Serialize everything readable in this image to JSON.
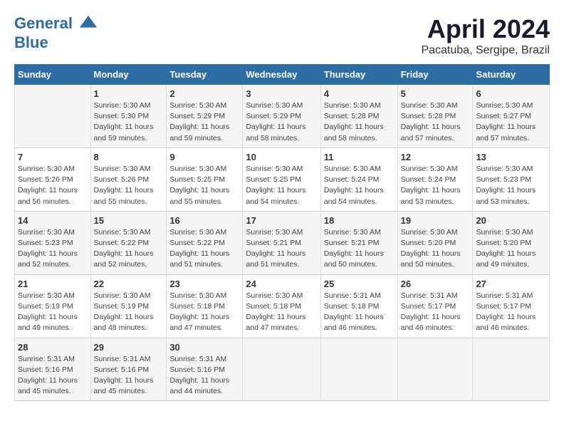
{
  "header": {
    "logo_line1": "General",
    "logo_line2": "Blue",
    "month": "April 2024",
    "location": "Pacatuba, Sergipe, Brazil"
  },
  "days_of_week": [
    "Sunday",
    "Monday",
    "Tuesday",
    "Wednesday",
    "Thursday",
    "Friday",
    "Saturday"
  ],
  "weeks": [
    [
      {
        "day": "",
        "info": ""
      },
      {
        "day": "1",
        "info": "Sunrise: 5:30 AM\nSunset: 5:30 PM\nDaylight: 11 hours\nand 59 minutes."
      },
      {
        "day": "2",
        "info": "Sunrise: 5:30 AM\nSunset: 5:29 PM\nDaylight: 11 hours\nand 59 minutes."
      },
      {
        "day": "3",
        "info": "Sunrise: 5:30 AM\nSunset: 5:29 PM\nDaylight: 11 hours\nand 58 minutes."
      },
      {
        "day": "4",
        "info": "Sunrise: 5:30 AM\nSunset: 5:28 PM\nDaylight: 11 hours\nand 58 minutes."
      },
      {
        "day": "5",
        "info": "Sunrise: 5:30 AM\nSunset: 5:28 PM\nDaylight: 11 hours\nand 57 minutes."
      },
      {
        "day": "6",
        "info": "Sunrise: 5:30 AM\nSunset: 5:27 PM\nDaylight: 11 hours\nand 57 minutes."
      }
    ],
    [
      {
        "day": "7",
        "info": "Sunrise: 5:30 AM\nSunset: 5:26 PM\nDaylight: 11 hours\nand 56 minutes."
      },
      {
        "day": "8",
        "info": "Sunrise: 5:30 AM\nSunset: 5:26 PM\nDaylight: 11 hours\nand 55 minutes."
      },
      {
        "day": "9",
        "info": "Sunrise: 5:30 AM\nSunset: 5:25 PM\nDaylight: 11 hours\nand 55 minutes."
      },
      {
        "day": "10",
        "info": "Sunrise: 5:30 AM\nSunset: 5:25 PM\nDaylight: 11 hours\nand 54 minutes."
      },
      {
        "day": "11",
        "info": "Sunrise: 5:30 AM\nSunset: 5:24 PM\nDaylight: 11 hours\nand 54 minutes."
      },
      {
        "day": "12",
        "info": "Sunrise: 5:30 AM\nSunset: 5:24 PM\nDaylight: 11 hours\nand 53 minutes."
      },
      {
        "day": "13",
        "info": "Sunrise: 5:30 AM\nSunset: 5:23 PM\nDaylight: 11 hours\nand 53 minutes."
      }
    ],
    [
      {
        "day": "14",
        "info": "Sunrise: 5:30 AM\nSunset: 5:23 PM\nDaylight: 11 hours\nand 52 minutes."
      },
      {
        "day": "15",
        "info": "Sunrise: 5:30 AM\nSunset: 5:22 PM\nDaylight: 11 hours\nand 52 minutes."
      },
      {
        "day": "16",
        "info": "Sunrise: 5:30 AM\nSunset: 5:22 PM\nDaylight: 11 hours\nand 51 minutes."
      },
      {
        "day": "17",
        "info": "Sunrise: 5:30 AM\nSunset: 5:21 PM\nDaylight: 11 hours\nand 51 minutes."
      },
      {
        "day": "18",
        "info": "Sunrise: 5:30 AM\nSunset: 5:21 PM\nDaylight: 11 hours\nand 50 minutes."
      },
      {
        "day": "19",
        "info": "Sunrise: 5:30 AM\nSunset: 5:20 PM\nDaylight: 11 hours\nand 50 minutes."
      },
      {
        "day": "20",
        "info": "Sunrise: 5:30 AM\nSunset: 5:20 PM\nDaylight: 11 hours\nand 49 minutes."
      }
    ],
    [
      {
        "day": "21",
        "info": "Sunrise: 5:30 AM\nSunset: 5:19 PM\nDaylight: 11 hours\nand 49 minutes."
      },
      {
        "day": "22",
        "info": "Sunrise: 5:30 AM\nSunset: 5:19 PM\nDaylight: 11 hours\nand 48 minutes."
      },
      {
        "day": "23",
        "info": "Sunrise: 5:30 AM\nSunset: 5:18 PM\nDaylight: 11 hours\nand 47 minutes."
      },
      {
        "day": "24",
        "info": "Sunrise: 5:30 AM\nSunset: 5:18 PM\nDaylight: 11 hours\nand 47 minutes."
      },
      {
        "day": "25",
        "info": "Sunrise: 5:31 AM\nSunset: 5:18 PM\nDaylight: 11 hours\nand 46 minutes."
      },
      {
        "day": "26",
        "info": "Sunrise: 5:31 AM\nSunset: 5:17 PM\nDaylight: 11 hours\nand 46 minutes."
      },
      {
        "day": "27",
        "info": "Sunrise: 5:31 AM\nSunset: 5:17 PM\nDaylight: 11 hours\nand 46 minutes."
      }
    ],
    [
      {
        "day": "28",
        "info": "Sunrise: 5:31 AM\nSunset: 5:16 PM\nDaylight: 11 hours\nand 45 minutes."
      },
      {
        "day": "29",
        "info": "Sunrise: 5:31 AM\nSunset: 5:16 PM\nDaylight: 11 hours\nand 45 minutes."
      },
      {
        "day": "30",
        "info": "Sunrise: 5:31 AM\nSunset: 5:16 PM\nDaylight: 11 hours\nand 44 minutes."
      },
      {
        "day": "",
        "info": ""
      },
      {
        "day": "",
        "info": ""
      },
      {
        "day": "",
        "info": ""
      },
      {
        "day": "",
        "info": ""
      }
    ]
  ]
}
